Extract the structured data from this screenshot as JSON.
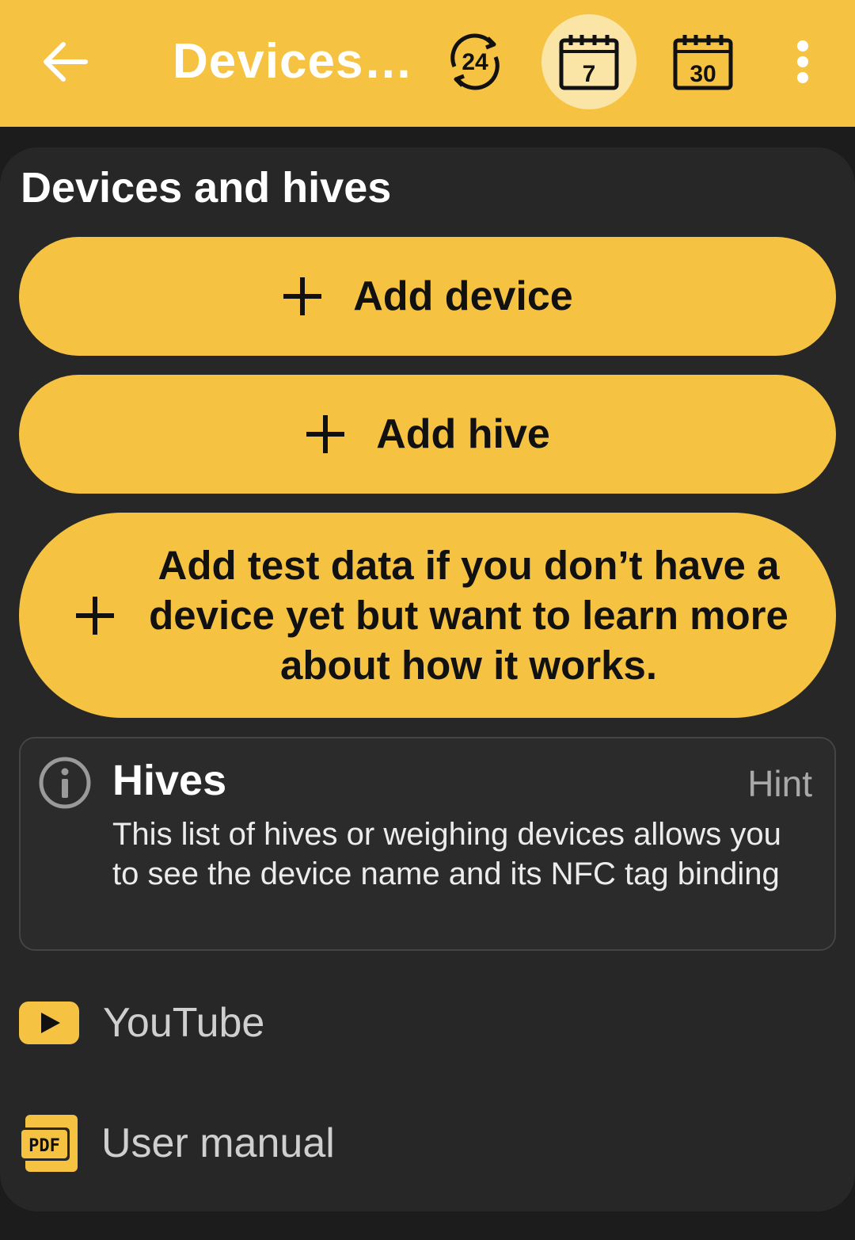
{
  "appbar": {
    "title": "Devices…",
    "period_24_label": "24",
    "period_7_label": "7",
    "period_30_label": "30",
    "accent": "#f5c242"
  },
  "main": {
    "section_title": "Devices and hives",
    "buttons": {
      "add_device": "Add device",
      "add_hive": "Add hive",
      "add_test_data": "Add test data if you don’t have a device yet but want to learn more about how it works."
    },
    "hint": {
      "title": "Hives",
      "tag": "Hint",
      "body": "This list of hives or weighing devices allows you to see the device name and its NFC tag binding"
    },
    "links": {
      "youtube": "YouTube",
      "manual": "User manual",
      "pdf_badge": "PDF"
    }
  }
}
